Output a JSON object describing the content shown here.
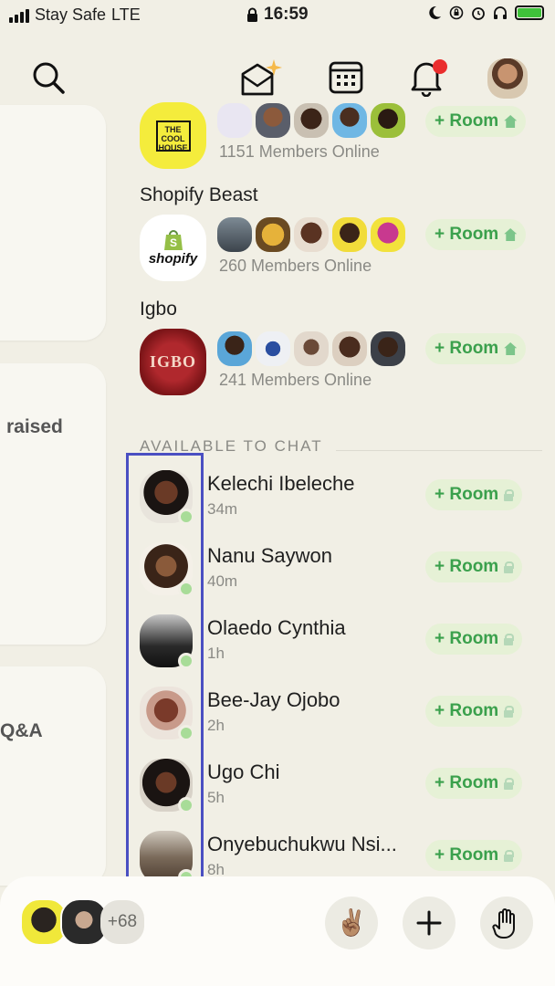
{
  "status_bar": {
    "carrier": "Stay Safe",
    "network": "LTE",
    "time": "16:59"
  },
  "header": {
    "icons": [
      "search-icon",
      "envelope-sparkle-icon",
      "calendar-icon",
      "bell-icon",
      "profile-avatar"
    ]
  },
  "side_panel": {
    "text_1": "raised",
    "text_2": "Q&A"
  },
  "clubs": [
    {
      "name": "",
      "logo_text": "THE COOL HOUSE",
      "members_online": "1151 Members Online",
      "room_label": "+ Room"
    },
    {
      "name": "Shopify Beast",
      "logo_text": "shopify",
      "members_online": "260 Members Online",
      "room_label": "+ Room"
    },
    {
      "name": "Igbo",
      "logo_text": "IGBO",
      "members_online": "241 Members Online",
      "room_label": "+ Room"
    }
  ],
  "available": {
    "title": "AVAILABLE TO CHAT",
    "people": [
      {
        "name": "Kelechi Ibeleche",
        "time": "34m",
        "room_label": "+ Room"
      },
      {
        "name": "Nanu Saywon",
        "time": "40m",
        "room_label": "+ Room"
      },
      {
        "name": "Olaedo Cynthia",
        "time": "1h",
        "room_label": "+ Room"
      },
      {
        "name": "Bee-Jay Ojobo",
        "time": "2h",
        "room_label": "+ Room"
      },
      {
        "name": "Ugo Chi",
        "time": "5h",
        "room_label": "+ Room"
      },
      {
        "name": "Onyebuchukwu Nsi...",
        "time": "8h",
        "room_label": "+ Room"
      }
    ]
  },
  "bottom_bar": {
    "count": "+68",
    "buttons": [
      "peace-hand-icon",
      "plus-icon",
      "raise-hand-icon"
    ]
  },
  "colors": {
    "background": "#f1efe5",
    "room_button_bg": "#e6f1d6",
    "room_button_text": "#3aa04c",
    "online_dot": "#a8dc98",
    "highlight": "#4a4fc2",
    "notification": "#ea2d2d"
  }
}
